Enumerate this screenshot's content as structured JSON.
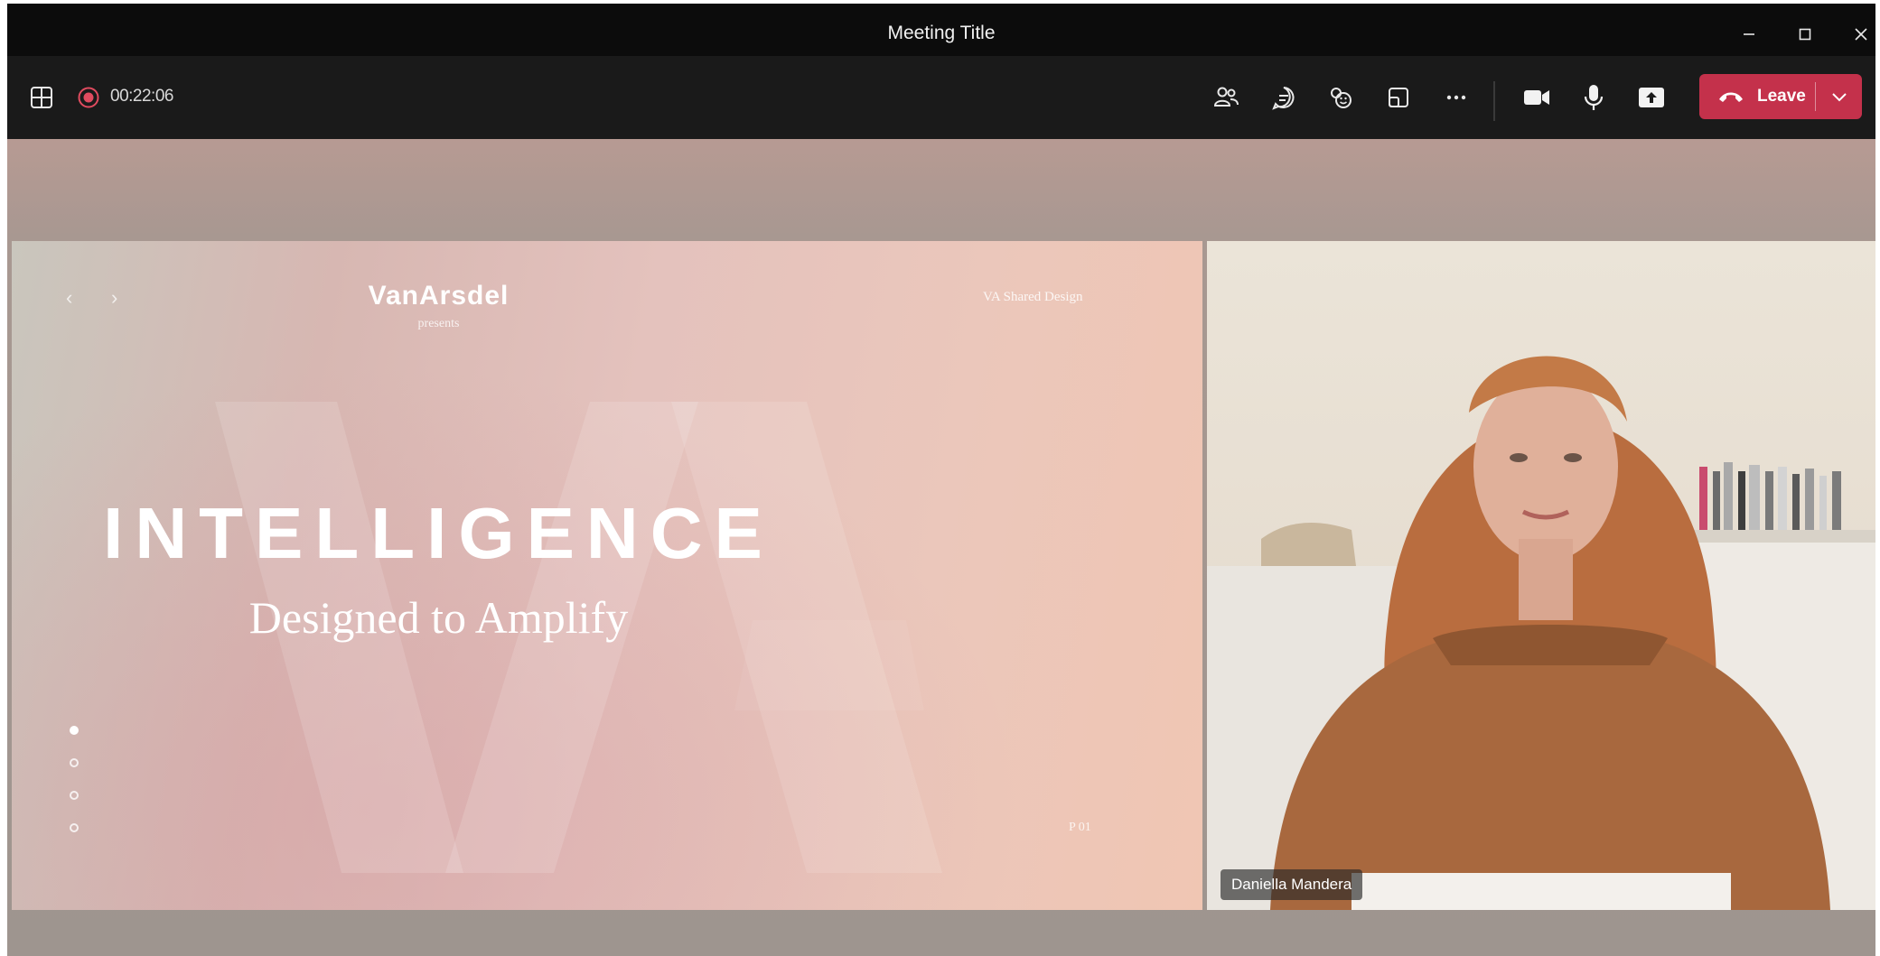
{
  "window": {
    "title": "Meeting Title"
  },
  "toolbar": {
    "recording_time": "00:22:06",
    "leave_label": "Leave"
  },
  "slide": {
    "logo": "VanArsdel",
    "presents": "presents",
    "corner_label": "VA Shared Design",
    "headline": "INTELLIGENCE",
    "subheadline": "Designed to Amplify",
    "page_number": "P 01",
    "pagination": {
      "total": 4,
      "current": 1
    }
  },
  "participant": {
    "name": "Daniella Mandera"
  },
  "colors": {
    "leave_button": "#c4314b",
    "titlebar": "#0c0c0c",
    "toolbar": "#1a1a1a"
  },
  "icons": {
    "layout": "grid-icon",
    "recording": "record-icon",
    "people": "people-icon",
    "chat": "chat-icon",
    "reactions": "reactions-icon",
    "rooms": "breakout-rooms-icon",
    "more": "more-icon",
    "camera": "camera-icon",
    "mic": "microphone-icon",
    "share": "share-screen-icon",
    "hangup": "phone-hangup-icon"
  }
}
